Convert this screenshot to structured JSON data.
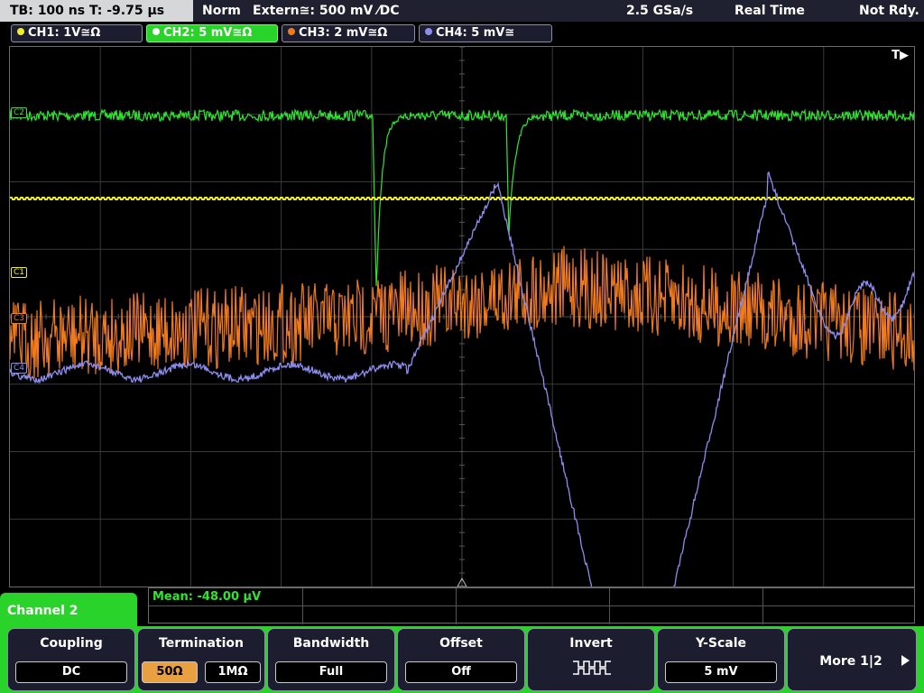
{
  "topbar": {
    "timebase": "TB: 100 ns   T: -9.75 µs",
    "trigger_mode": "Norm",
    "trigger_source": "Extern≅: 500 mV ⁄DC",
    "sample_rate": "2.5 GSa/s",
    "acq_mode": "Real Time",
    "status": "Not Rdy."
  },
  "channels": [
    {
      "label": "CH1: 1V≅Ω",
      "color": "#f0ee2a"
    },
    {
      "label": "CH2: 5 mV≅Ω",
      "color": "#2ee62e"
    },
    {
      "label": "CH3: 2 mV≅Ω",
      "color": "#f07a1e"
    },
    {
      "label": "CH4: 5 mV≅",
      "color": "#8d8df0"
    }
  ],
  "plot": {
    "trigger_flag": "T▶",
    "markers": [
      "C2",
      "C1",
      "C3",
      "C4"
    ]
  },
  "measurement": {
    "text": "Mean: -48.00 µV"
  },
  "active_channel": "Channel 2",
  "softkeys": {
    "coupling": {
      "title": "Coupling",
      "value": "DC"
    },
    "termination": {
      "title": "Termination",
      "options": [
        "50Ω",
        "1MΩ"
      ],
      "selected": "50Ω"
    },
    "bandwidth": {
      "title": "Bandwidth",
      "value": "Full"
    },
    "offset": {
      "title": "Offset",
      "value": "Off"
    },
    "invert": {
      "title": "Invert",
      "icon": "invert-waveform-icon"
    },
    "yscale": {
      "title": "Y-Scale",
      "value": "5 mV"
    },
    "more": {
      "label": "More 1|2",
      "icon": "arrow-right-icon"
    }
  }
}
